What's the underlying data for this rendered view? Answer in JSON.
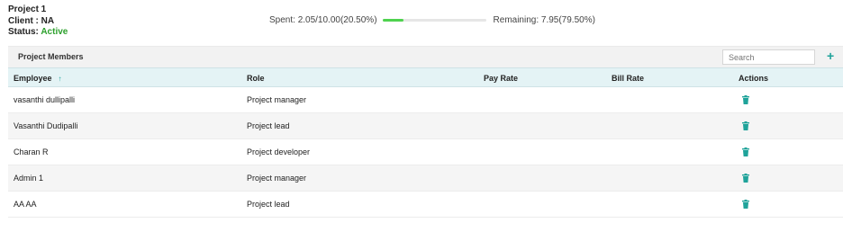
{
  "project": {
    "name": "Project 1",
    "client": "Client : NA",
    "status_label": "Status:",
    "status_value": "Active"
  },
  "budget": {
    "spent_text": "Spent:  2.05/10.00(20.50%)",
    "remaining_text": "Remaining:  7.95(79.50%)",
    "spent_fraction": 0.205
  },
  "members_panel": {
    "title": "Project Members",
    "search_placeholder": "Search",
    "add_icon": "plus-icon",
    "columns": [
      "Employee",
      "Role",
      "Pay Rate",
      "Bill Rate",
      "Actions"
    ],
    "sort_indicator": "↑",
    "rows": [
      {
        "employee": "vasanthi dullipalli",
        "role": "Project manager",
        "pay_rate": "",
        "bill_rate": ""
      },
      {
        "employee": "Vasanthi Dudipalli",
        "role": "Project lead",
        "pay_rate": "",
        "bill_rate": ""
      },
      {
        "employee": "Charan R",
        "role": "Project developer",
        "pay_rate": "",
        "bill_rate": ""
      },
      {
        "employee": "Admin 1",
        "role": "Project manager",
        "pay_rate": "",
        "bill_rate": ""
      },
      {
        "employee": "AA AA",
        "role": "Project lead",
        "pay_rate": "",
        "bill_rate": ""
      }
    ],
    "action_icon": "trash-icon"
  },
  "colors": {
    "accent": "#1fa39a",
    "status_active": "#2ca02c",
    "progress": "#4fd24f",
    "header_bg": "#e4f3f5"
  }
}
